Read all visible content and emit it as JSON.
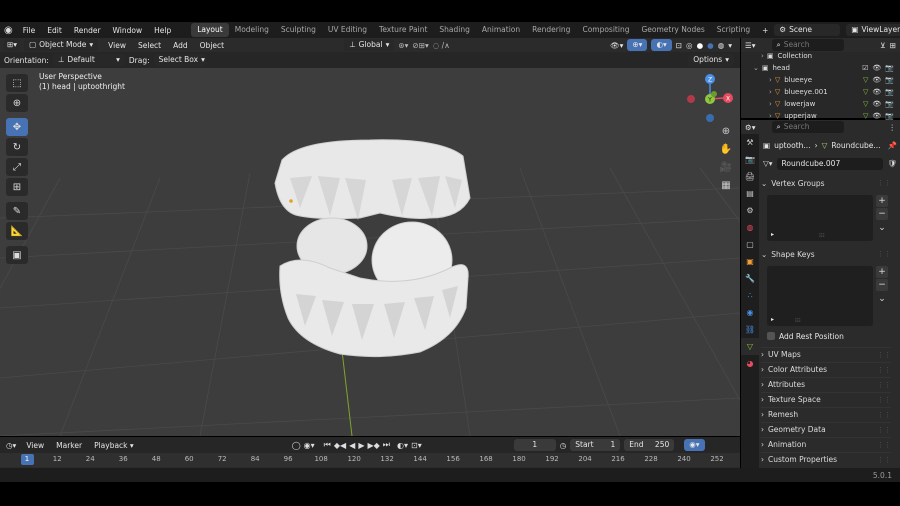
{
  "app": {
    "version": "5.0.1"
  },
  "menu": {
    "items": [
      "File",
      "Edit",
      "Render",
      "Window",
      "Help"
    ]
  },
  "workspaces": [
    {
      "label": "Layout",
      "active": true
    },
    {
      "label": "Modeling",
      "active": false
    },
    {
      "label": "Sculpting",
      "active": false
    },
    {
      "label": "UV Editing",
      "active": false
    },
    {
      "label": "Texture Paint",
      "active": false
    },
    {
      "label": "Shading",
      "active": false
    },
    {
      "label": "Animation",
      "active": false
    },
    {
      "label": "Rendering",
      "active": false
    },
    {
      "label": "Compositing",
      "active": false
    },
    {
      "label": "Geometry Nodes",
      "active": false
    },
    {
      "label": "Scripting",
      "active": false
    }
  ],
  "add_workspace": "+",
  "scene": {
    "label": "Scene",
    "view_layer": "ViewLayer"
  },
  "viewport_header": {
    "mode": "Object Mode",
    "menus": [
      "View",
      "Select",
      "Add",
      "Object"
    ],
    "transform": "Global"
  },
  "tool_header": {
    "orientation_label": "Orientation:",
    "orientation_value": "Default",
    "drag_label": "Drag:",
    "drag_value": "Select Box",
    "options": "Options"
  },
  "viewport": {
    "perspective": "User Perspective",
    "object_info": "(1) head | uptoothright"
  },
  "gizmo": {
    "axes": [
      "X",
      "Y",
      "Z"
    ],
    "colors": {
      "x": "#e84a5f",
      "y": "#8fc73e",
      "z": "#4a8fe8"
    }
  },
  "tools": [
    "select-box",
    "cursor",
    "move",
    "rotate",
    "scale",
    "transform",
    "annotate",
    "measure",
    "add-cube"
  ],
  "timeline": {
    "menus": [
      "View",
      "Marker",
      "Playback"
    ],
    "current_frame": "1",
    "start_label": "Start",
    "start": "1",
    "end_label": "End",
    "end": "250",
    "ticks": [
      "1",
      "12",
      "24",
      "36",
      "48",
      "60",
      "72",
      "84",
      "96",
      "108",
      "120",
      "132",
      "144",
      "156",
      "168",
      "180",
      "192",
      "204",
      "216",
      "228",
      "240",
      "252"
    ]
  },
  "outliner": {
    "search_placeholder": "Search",
    "rows": [
      {
        "label": "Collection",
        "indent": 2
      },
      {
        "label": "head",
        "indent": 1
      },
      {
        "label": "blueeye",
        "indent": 3
      },
      {
        "label": "blueeye.001",
        "indent": 3
      },
      {
        "label": "lowerjaw",
        "indent": 3
      },
      {
        "label": "upperjaw",
        "indent": 3
      }
    ]
  },
  "properties": {
    "search_placeholder": "Search",
    "breadcrumb": [
      "uptooth...",
      "Roundcube..."
    ],
    "mesh_name": "Roundcube.007",
    "panels": {
      "vertex_groups": "Vertex Groups",
      "shape_keys": "Shape Keys",
      "add_rest_position": "Add Rest Position"
    },
    "collapsed_panels": [
      "UV Maps",
      "Color Attributes",
      "Attributes",
      "Texture Space",
      "Remesh",
      "Geometry Data",
      "Animation",
      "Custom Properties"
    ]
  },
  "colors": {
    "accent": "#4772b3",
    "viewport_bg": "#3d3d3d",
    "mesh": "#ececec"
  }
}
